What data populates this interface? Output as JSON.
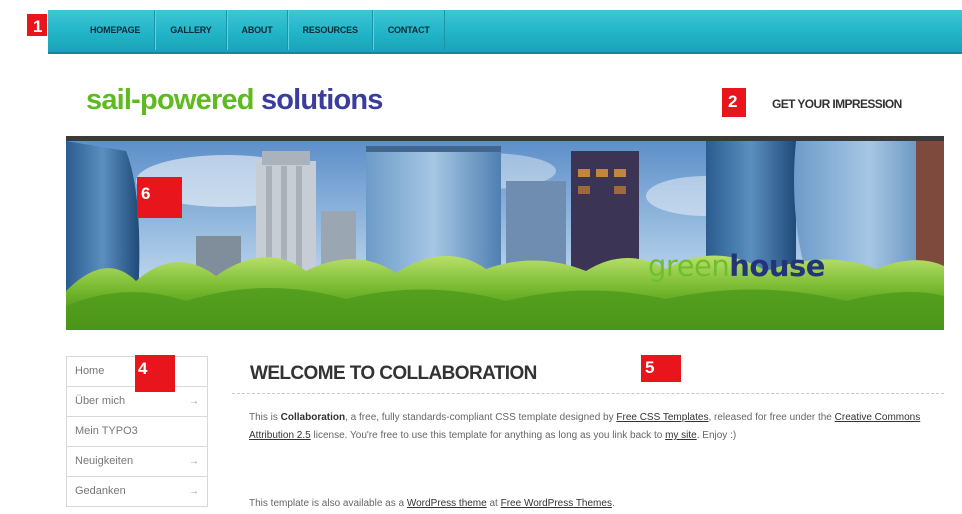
{
  "nav": {
    "items": [
      "HOMEPAGE",
      "GALLERY",
      "ABOUT",
      "RESOURCES",
      "CONTACT"
    ]
  },
  "markers": [
    "1",
    "2",
    "4",
    "5",
    "6"
  ],
  "logo": {
    "part1": "sail-powered",
    "part2": "solutions"
  },
  "header": {
    "impression": "GET YOUR IMPRESSION"
  },
  "banner": {
    "word_green": "green",
    "word_house": "house"
  },
  "sidebar": {
    "items": [
      {
        "label": "Home",
        "arrow": ""
      },
      {
        "label": "Über mich",
        "arrow": "→"
      },
      {
        "label": "Mein TYPO3",
        "arrow": ""
      },
      {
        "label": "Neuigkeiten",
        "arrow": "→"
      },
      {
        "label": "Gedanken",
        "arrow": "→"
      }
    ]
  },
  "content": {
    "title": "WELCOME TO COLLABORATION",
    "p1": {
      "t1": "This is ",
      "b1": "Collaboration",
      "t2": ", a free, fully standards-compliant CSS template designed by ",
      "l1": "Free CSS Templates",
      "t3": ", released for free under the ",
      "l2": "Creative Commons Attribution 2.5",
      "t4": " license. You're free to use this template for anything as long as you link back to ",
      "l3": "my site",
      "t5": ". Enjoy :)"
    },
    "p2": {
      "t1": "This template is also available as a ",
      "l1": "WordPress theme",
      "t2": " at ",
      "l2": "Free WordPress Themes",
      "t3": "."
    }
  },
  "colors": {
    "nav": "#21b4c8",
    "logo_green": "#5dbb1f",
    "logo_blue": "#3a3d9d",
    "marker": "#e8151c"
  }
}
